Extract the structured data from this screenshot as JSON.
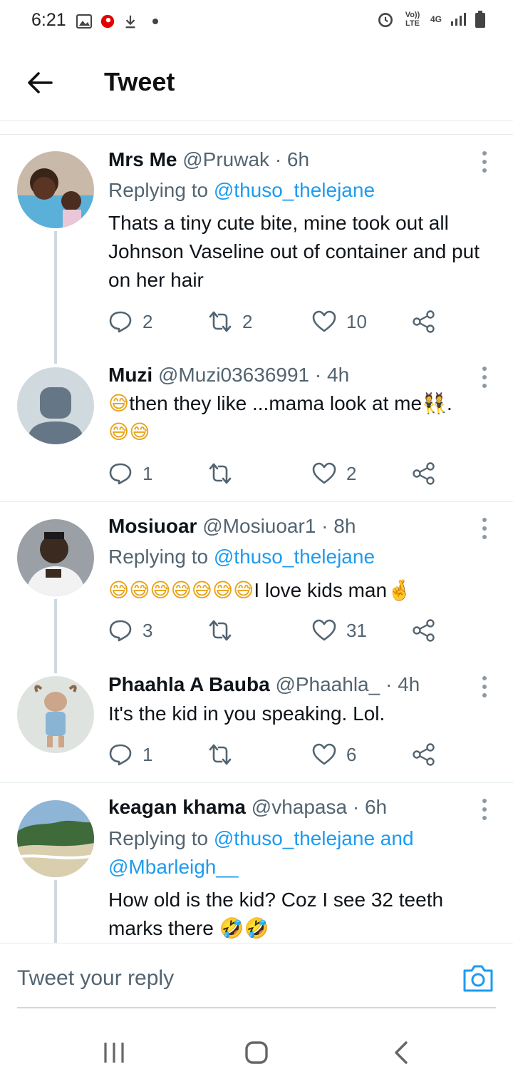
{
  "status_bar": {
    "time": "6:21",
    "network_label": "Vo)) LTE",
    "network_type": "4G",
    "icons": [
      "image-icon",
      "vodafone-icon",
      "download-icon",
      "dot-icon",
      "alarm-icon",
      "signal-icon",
      "battery-icon"
    ]
  },
  "header": {
    "title": "Tweet",
    "back_icon": "arrow-left-icon"
  },
  "tweets": [
    {
      "name": "Mrs Me",
      "meta": "@Pruwak · 6h",
      "replying_prefix": "Replying to ",
      "replying_to": "@thuso_thelejane",
      "text": "Thats a tiny cute bite, mine took out all Johnson Vaseline out of container and put on her hair",
      "replies": "2",
      "retweets": "2",
      "likes": "10"
    },
    {
      "name": "Muzi",
      "meta": "@Muzi03636991 · 4h",
      "text_parts": [
        "😅",
        "then they like ...mama look at me",
        "👯",
        ".",
        "😅😅"
      ],
      "replies": "1",
      "retweets": "",
      "likes": "2"
    },
    {
      "name": "Mosiuoar",
      "meta": "@Mosiuoar1 · 8h",
      "replying_prefix": "Replying to ",
      "replying_to": "@thuso_thelejane",
      "text_parts": [
        "😅😅😅😅😅😅😅",
        "I love kids man",
        "🤞"
      ],
      "replies": "3",
      "retweets": "",
      "likes": "31"
    },
    {
      "name": "Phaahla A Bauba",
      "meta": "@Phaahla_ · 4h",
      "text": "It's the kid in you speaking. Lol.",
      "replies": "1",
      "retweets": "",
      "likes": "6"
    },
    {
      "name": "keagan khama",
      "meta": "@vhapasa · 6h",
      "replying_prefix": "Replying to ",
      "replying_to": "@thuso_thelejane and",
      "replying_to_2": "@Mbarleigh__",
      "text_parts": [
        "How old is the kid? Coz I see 32 teeth marks there ",
        "🤣🤣"
      ]
    }
  ],
  "reply_bar": {
    "placeholder": "Tweet your reply",
    "camera_icon": "camera-icon"
  },
  "nav_bar": {
    "icons": [
      "recents-icon",
      "home-icon",
      "back-icon"
    ]
  },
  "colors": {
    "link": "#1d9bf0",
    "muted": "#536471",
    "text": "#0f1419",
    "thread": "#cfd9de"
  }
}
